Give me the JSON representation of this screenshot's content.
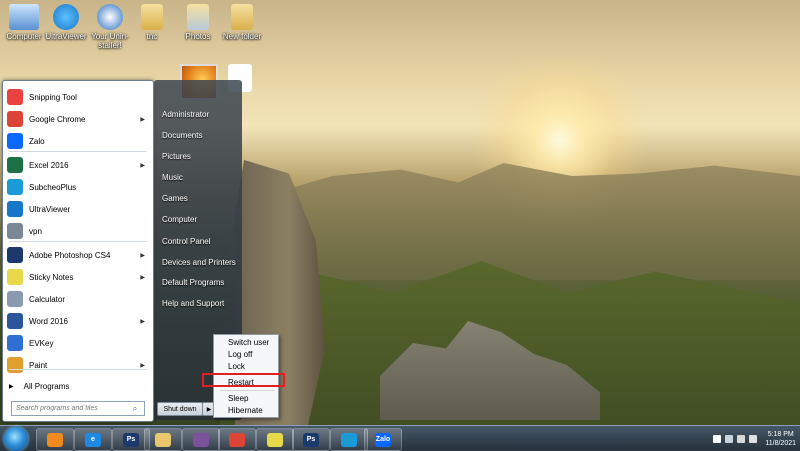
{
  "desktop": {
    "icons": [
      {
        "label": "Computer"
      },
      {
        "label": "UltraViewer"
      },
      {
        "label": "Your Unin-staller!"
      },
      {
        "label": "tnc"
      },
      {
        "label": "Photos"
      },
      {
        "label": "New folder"
      }
    ]
  },
  "start_menu": {
    "programs": [
      {
        "label": "Snipping Tool",
        "icon": "scissors-icon",
        "color": "#e94040",
        "arrow": false
      },
      {
        "label": "Google Chrome",
        "icon": "chrome-icon",
        "color": "#db4437",
        "arrow": true
      },
      {
        "label": "Zalo",
        "icon": "zalo-icon",
        "color": "#0a68ff",
        "arrow": false
      },
      {
        "label": "Excel 2016",
        "icon": "excel-icon",
        "color": "#1e7145",
        "arrow": true
      },
      {
        "label": "SubcheoPlus",
        "icon": "subcheoplus-icon",
        "color": "#1a9ad6",
        "arrow": false
      },
      {
        "label": "UltraViewer",
        "icon": "ultraviewer-icon",
        "color": "#1677c8",
        "arrow": false
      },
      {
        "label": "vpn",
        "icon": "vpn-icon",
        "color": "#7b8794",
        "arrow": false
      },
      {
        "label": "Adobe Photoshop CS4",
        "icon": "photoshop-icon",
        "color": "#1b3a6b",
        "arrow": true
      },
      {
        "label": "Sticky Notes",
        "icon": "sticky-notes-icon",
        "color": "#e8d94a",
        "arrow": true
      },
      {
        "label": "Calculator",
        "icon": "calculator-icon",
        "color": "#8a9bb0",
        "arrow": false
      },
      {
        "label": "Word 2016",
        "icon": "word-icon",
        "color": "#2b579a",
        "arrow": true
      },
      {
        "label": "EVKey",
        "icon": "evkey-icon",
        "color": "#2f6fd1",
        "arrow": false
      },
      {
        "label": "Paint",
        "icon": "paint-icon",
        "color": "#e0a030",
        "arrow": true
      }
    ],
    "all_programs": "All Programs",
    "search_placeholder": "Search programs and files",
    "right_links": [
      "Administrator",
      "Documents",
      "Pictures",
      "Music",
      "Games",
      "Computer",
      "Control Panel",
      "Devices and Printers",
      "Default Programs",
      "Help and Support"
    ],
    "shutdown_label": "Shut down",
    "shutdown_arrow": "▶"
  },
  "power_menu": {
    "items": [
      "Switch user",
      "Log off",
      "Lock",
      "Restart",
      "Sleep",
      "Hibernate"
    ],
    "highlighted": "Restart",
    "highlight_color": "#e02020"
  },
  "taskbar": {
    "pinned": [
      {
        "name": "media-player-icon",
        "text": "",
        "color": "#f08a1c"
      },
      {
        "name": "internet-explorer-icon",
        "text": "e",
        "color": "#1e88e5"
      },
      {
        "name": "photoshop-icon",
        "text": "Ps",
        "color": "#1b3a6b"
      },
      {
        "name": "file-explorer-icon",
        "text": "",
        "color": "#e8c86a"
      },
      {
        "name": "viber-icon",
        "text": "",
        "color": "#7b519d"
      },
      {
        "name": "chrome-icon",
        "text": "",
        "color": "#db4437"
      },
      {
        "name": "sticky-notes-icon",
        "text": "",
        "color": "#e8d94a"
      },
      {
        "name": "photoshop-icon-2",
        "text": "Ps",
        "color": "#1b3a6b"
      },
      {
        "name": "subcheoplus-icon",
        "text": "",
        "color": "#1a9ad6"
      },
      {
        "name": "zalo-icon",
        "text": "Zalo",
        "color": "#0a68ff"
      }
    ],
    "clock_time": "5:18 PM",
    "clock_date": "11/8/2021"
  }
}
